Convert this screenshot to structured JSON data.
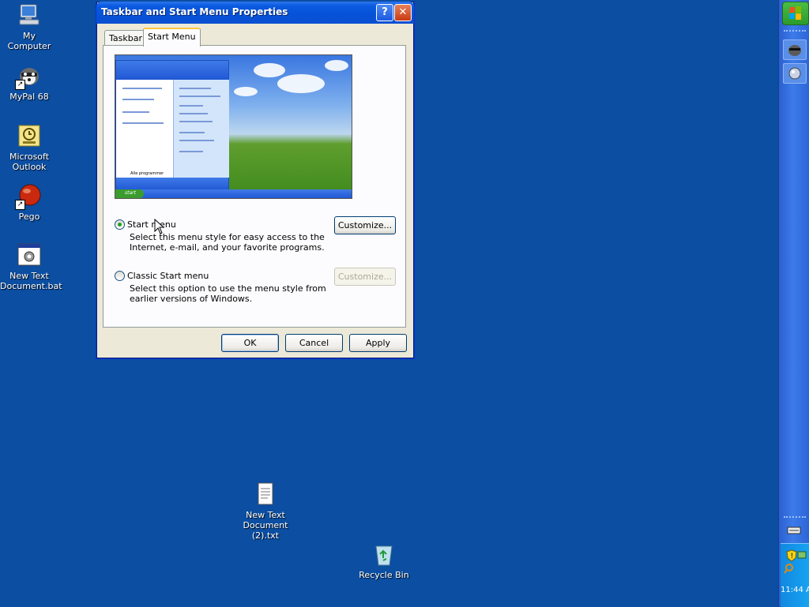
{
  "desktop": {
    "icons": [
      {
        "label": "My Computer",
        "icon": "computer-icon"
      },
      {
        "label": "MyPal 68",
        "icon": "raccoon-browser-icon"
      },
      {
        "label": "Microsoft Outlook",
        "icon": "outlook-icon"
      },
      {
        "label": "Pego",
        "icon": "red-ball-icon"
      },
      {
        "label": "New Text Document.bat",
        "icon": "batch-file-icon"
      },
      {
        "label": "New Text Document (2).txt",
        "icon": "text-file-icon"
      },
      {
        "label": "Recycle Bin",
        "icon": "recycle-bin-icon"
      }
    ]
  },
  "dialog": {
    "title": "Taskbar and Start Menu Properties",
    "help_glyph": "?",
    "close_glyph": "✕",
    "tabs": [
      {
        "label": "Taskbar",
        "active": false
      },
      {
        "label": "Start Menu",
        "active": true
      }
    ],
    "preview": {
      "start_label": "start",
      "menu_footer": "Alle programmer"
    },
    "options": [
      {
        "label": "Start menu",
        "selected": true,
        "description_line1": "Select this menu style for easy access to the",
        "description_line2": "Internet, e-mail, and your favorite programs.",
        "customize_label": "Customize...",
        "customize_enabled": true
      },
      {
        "label": "Classic Start menu",
        "selected": false,
        "description_line1": "Select this option to use the menu style from",
        "description_line2": "earlier versions of Windows.",
        "customize_label": "Customize...",
        "customize_enabled": false
      }
    ],
    "buttons": {
      "ok": "OK",
      "cancel": "Cancel",
      "apply": "Apply"
    }
  },
  "taskbar": {
    "clock": "11:44 A"
  },
  "colors": {
    "desktop": "#0b4ea2",
    "title_bar": "#0a5ae0",
    "dialog_face": "#ece9d8"
  }
}
